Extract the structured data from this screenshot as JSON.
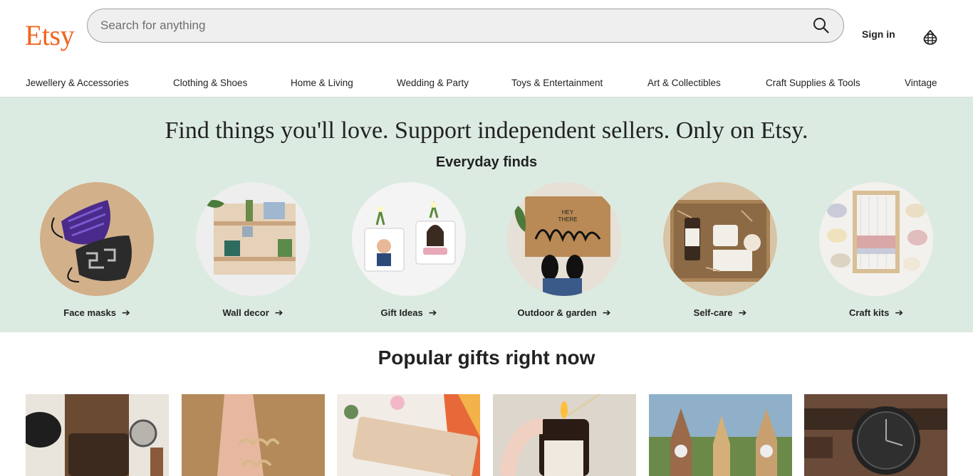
{
  "header": {
    "logo": "Etsy",
    "search_placeholder": "Search for anything",
    "sign_in": "Sign in",
    "search_icon": "search-icon",
    "cart_icon": "basket-icon"
  },
  "nav": {
    "items": [
      "Jewellery & Accessories",
      "Clothing & Shoes",
      "Home & Living",
      "Wedding & Party",
      "Toys & Entertainment",
      "Art & Collectibles",
      "Craft Supplies & Tools",
      "Vintage"
    ]
  },
  "hero": {
    "title": "Find things you'll love. Support independent sellers. Only on Etsy.",
    "subtitle": "Everyday finds",
    "categories": [
      {
        "label": "Face masks"
      },
      {
        "label": "Wall decor"
      },
      {
        "label": "Gift Ideas"
      },
      {
        "label": "Outdoor & garden"
      },
      {
        "label": "Self-care"
      },
      {
        "label": "Craft kits"
      }
    ]
  },
  "popular": {
    "title": "Popular gifts right now"
  },
  "colors": {
    "brand": "#F1641E",
    "hero_bg": "#DCEBE1"
  }
}
